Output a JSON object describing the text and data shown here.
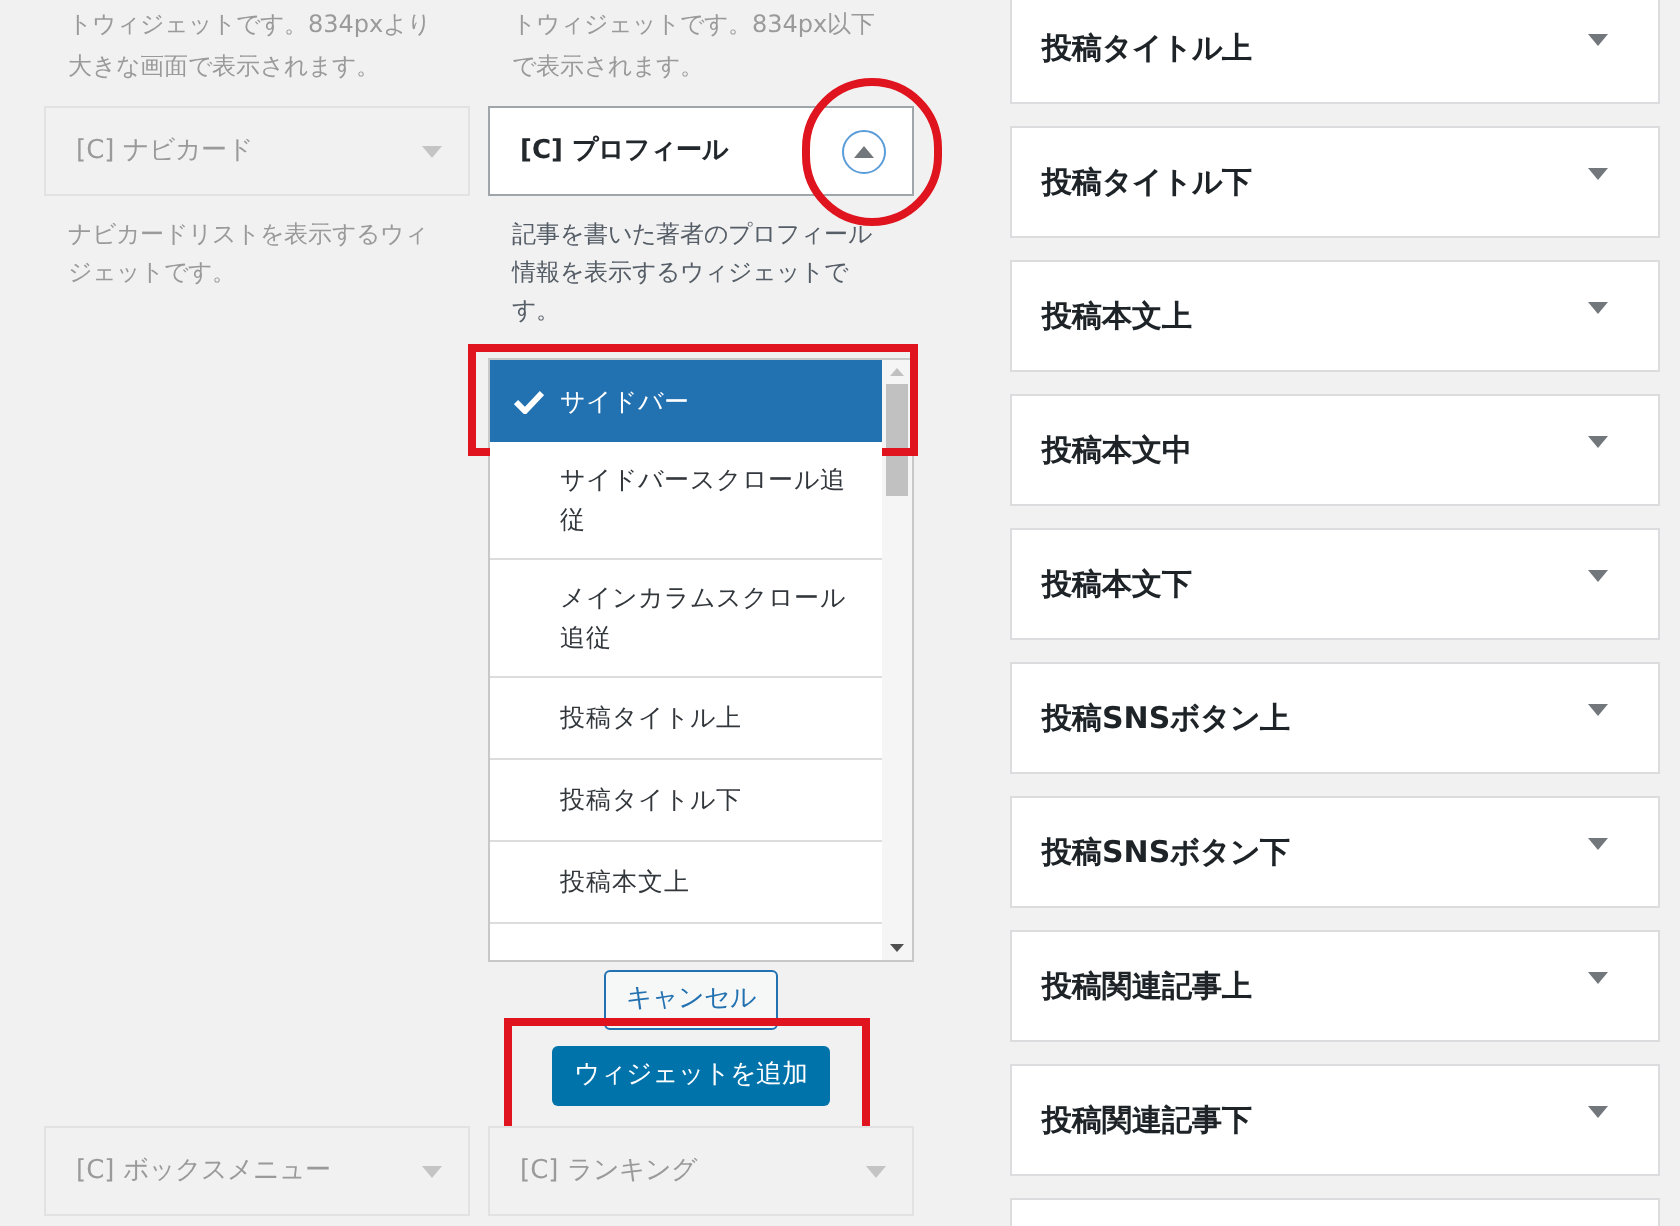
{
  "top_notes": [
    "トウィジェットです。834pxより大きな画面で表示されます。",
    "トウィジェットです。834px以下で表示されます。"
  ],
  "widgets": [
    {
      "title": "[C] ナビカード",
      "dimmed": true,
      "expanded": false,
      "annotated": false,
      "description": "ナビカードリストを表示するウィジェットです。"
    },
    {
      "title": "[C] プロフィール",
      "dimmed": false,
      "expanded": true,
      "annotated": true,
      "description": "記事を書いた著者のプロフィール情報を表示するウィジェットです。"
    }
  ],
  "area_chooser": {
    "areas": [
      {
        "label": "サイドバー",
        "selected": true,
        "annotated": true
      },
      {
        "label": "サイドバースクロール追従",
        "selected": false,
        "annotated": false
      },
      {
        "label": "メインカラムスクロール追従",
        "selected": false,
        "annotated": false
      },
      {
        "label": "投稿タイトル上",
        "selected": false,
        "annotated": false
      },
      {
        "label": "投稿タイトル下",
        "selected": false,
        "annotated": false
      },
      {
        "label": "投稿本文上",
        "selected": false,
        "annotated": false
      }
    ],
    "cancel_button": {
      "label": "キャンセル"
    },
    "add_button": {
      "label": "ウィジェットを追加",
      "annotated": true
    }
  },
  "bottom_widgets": [
    {
      "title": "[C] ボックスメニュー",
      "dimmed": true,
      "expanded": false
    },
    {
      "title": "[C] ランキング",
      "dimmed": true,
      "expanded": false
    }
  ],
  "widget_areas": [
    {
      "title": "投稿タイトル上",
      "expanded": false
    },
    {
      "title": "投稿タイトル下",
      "expanded": false
    },
    {
      "title": "投稿本文上",
      "expanded": false
    },
    {
      "title": "投稿本文中",
      "expanded": false
    },
    {
      "title": "投稿本文下",
      "expanded": false
    },
    {
      "title": "投稿SNSボタン上",
      "expanded": false
    },
    {
      "title": "投稿SNSボタン下",
      "expanded": false
    },
    {
      "title": "投稿関連記事上",
      "expanded": false
    },
    {
      "title": "投稿関連記事下",
      "expanded": false
    }
  ]
}
